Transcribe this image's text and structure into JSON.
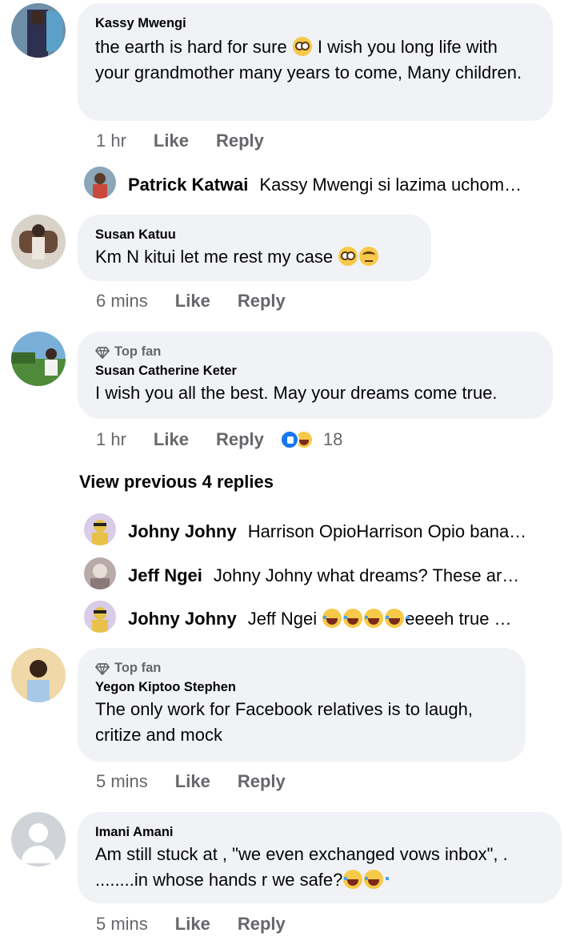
{
  "comments": [
    {
      "name": "Kassy Mwengi",
      "text_parts": [
        "the earth is hard for sure ",
        " I wish you long life with your grandmother many years to come, Many children."
      ],
      "time": "1 hr"
    },
    {
      "name": "Susan Katuu",
      "text": "Km N kitui let me rest my case ",
      "time": "6 mins"
    },
    {
      "badge": "Top fan",
      "name": "Susan Catherine Keter",
      "text": "I wish you all the best. May your dreams come true.",
      "time": "1 hr",
      "reaction_count": "18"
    },
    {
      "badge": "Top fan",
      "name": "Yegon Kiptoo Stephen",
      "text": "The only work for Facebook relatives is to laugh, critize and mock",
      "time": "5 mins"
    },
    {
      "name": "Imani Amani",
      "text_line1": "Am still stuck at , \"we even exchanged vows inbox\", .",
      "text_line2": "........in whose hands r we safe?",
      "time": "5 mins"
    }
  ],
  "replies": [
    {
      "name": "Patrick Katwai",
      "text": "Kassy Mwengi si lazima uchom…"
    },
    {
      "name": "Johny Johny",
      "text": "Harrison OpioHarrison Opio bana…"
    },
    {
      "name": "Jeff Ngei",
      "text": "Johny Johny what dreams? These ar…"
    },
    {
      "name": "Johny Johny",
      "text": "Jeff Ngei",
      "suffix": "eeeeh true …"
    }
  ],
  "actions": {
    "like": "Like",
    "reply": "Reply"
  },
  "view_previous": "View previous 4 replies",
  "icons": [
    "diamond-icon",
    "like-reaction-icon",
    "haha-reaction-icon",
    "flushed-emoji",
    "eye-roll-emoji",
    "tears-of-joy-emoji"
  ],
  "colors": {
    "bubble": "#f0f2f5",
    "meta": "#65676b",
    "like_blue": "#1877f2"
  }
}
